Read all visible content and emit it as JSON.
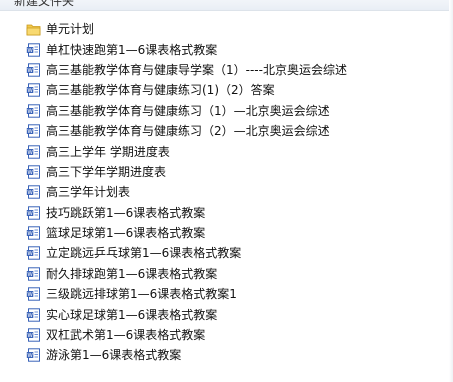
{
  "window": {
    "title": "新建文件夹"
  },
  "items": [
    {
      "label": "单元计划",
      "icon": "folder-icon"
    },
    {
      "label": "单杠快速跑第1—6课表格式教案",
      "icon": "word-doc-icon"
    },
    {
      "label": "高三基能教学体育与健康导学案（1）----北京奥运会综述",
      "icon": "word-doc-icon"
    },
    {
      "label": "高三基能教学体育与健康练习(1)（2）答案",
      "icon": "word-doc-icon"
    },
    {
      "label": "高三基能教学体育与健康练习（1）—北京奥运会综述",
      "icon": "word-doc-icon"
    },
    {
      "label": "高三基能教学体育与健康练习（2）—北京奥运会综述",
      "icon": "word-doc-icon"
    },
    {
      "label": "高三上学年 学期进度表",
      "icon": "word-doc-icon"
    },
    {
      "label": "高三下学年学期进度表",
      "icon": "word-doc-icon"
    },
    {
      "label": "高三学年计划表",
      "icon": "word-doc-icon"
    },
    {
      "label": "技巧跳跃第1—6课表格式教案",
      "icon": "word-doc-icon"
    },
    {
      "label": "篮球足球第1—6课表格式教案",
      "icon": "word-doc-icon"
    },
    {
      "label": "立定跳远乒乓球第1—6课表格式教案",
      "icon": "word-doc-icon"
    },
    {
      "label": "耐久排球跑第1—6课表格式教案",
      "icon": "word-doc-icon"
    },
    {
      "label": "三级跳远排球第1—6课表格式教案1",
      "icon": "word-doc-icon"
    },
    {
      "label": "实心球足球第1—6课表格式教案",
      "icon": "word-doc-icon"
    },
    {
      "label": "双杠武术第1—6课表格式教案",
      "icon": "word-doc-icon"
    },
    {
      "label": "游泳第1—6课表格式教案",
      "icon": "word-doc-icon"
    }
  ],
  "colors": {
    "folder": "#f2c84b",
    "doc_border": "#3a63b8",
    "doc_fill": "#ffffff",
    "doc_lines": "#4a74c9"
  }
}
